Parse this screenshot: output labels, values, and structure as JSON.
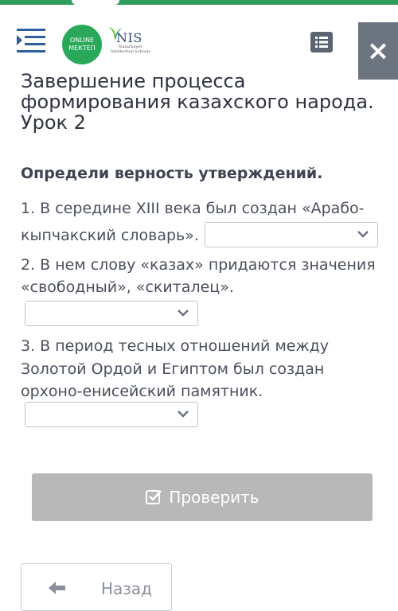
{
  "header": {
    "logo_online_line1": "ONLINE",
    "logo_online_line2": "МЕКТЕП",
    "logo_nis_text": "NIS",
    "logo_nis_subtitle": "Nazarbayev Intellectual Schools",
    "close_glyph": "×"
  },
  "lesson": {
    "title": "Завершение процесса формирования казахского народа. Урок 2",
    "instruction": "Определи верность утверждений.",
    "statements": [
      {
        "line1": "1. В середине XIII века был создан «Арабо-",
        "line2": "кыпчакский словарь».",
        "selected": ""
      },
      {
        "line1": "2. В нем слову «казах» придаются значения",
        "line2": "«свободный», «скиталец».",
        "selected": ""
      },
      {
        "line1": "3. В период тесных отношений между",
        "line2": "Золотой Ордой и Египтом был создан",
        "line3": "орхоно-енисейский памятник.",
        "selected": ""
      }
    ]
  },
  "actions": {
    "check_label": "Проверить",
    "back_label": "Назад"
  },
  "colors": {
    "brand_green": "#2aa85a",
    "check_button": "#b8b8b8",
    "close_button": "#6c7480"
  }
}
